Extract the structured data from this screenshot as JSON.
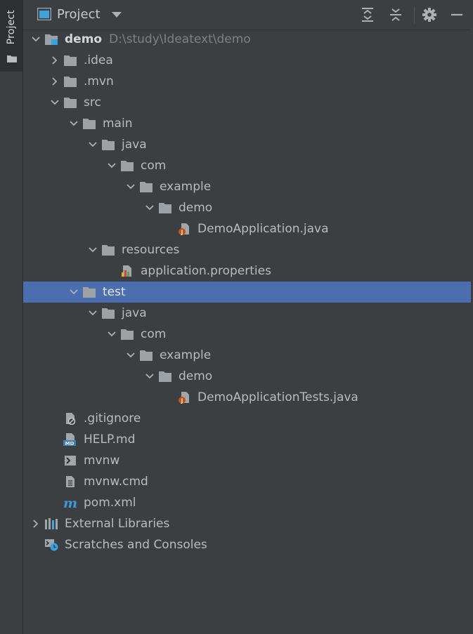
{
  "toolstrip": {
    "tab_label": "Project"
  },
  "header": {
    "title": "Project"
  },
  "tree": [
    {
      "label": "demo",
      "path": "D:\\study\\Ideatext\\demo",
      "icon": "module-folder-icon",
      "chevron": "down",
      "indent": 0,
      "bold": true
    },
    {
      "label": ".idea",
      "icon": "folder-icon",
      "chevron": "right",
      "indent": 1
    },
    {
      "label": ".mvn",
      "icon": "folder-icon",
      "chevron": "right",
      "indent": 1
    },
    {
      "label": "src",
      "icon": "folder-icon",
      "chevron": "down",
      "indent": 1
    },
    {
      "label": "main",
      "icon": "folder-icon",
      "chevron": "down",
      "indent": 2
    },
    {
      "label": "java",
      "icon": "folder-icon",
      "chevron": "down",
      "indent": 3
    },
    {
      "label": "com",
      "icon": "folder-icon",
      "chevron": "down",
      "indent": 4
    },
    {
      "label": "example",
      "icon": "folder-icon",
      "chevron": "down",
      "indent": 5
    },
    {
      "label": "demo",
      "icon": "folder-icon",
      "chevron": "down",
      "indent": 6
    },
    {
      "label": "DemoApplication.java",
      "icon": "java-file-icon",
      "chevron": "none",
      "indent": 7
    },
    {
      "label": "resources",
      "icon": "folder-icon",
      "chevron": "down",
      "indent": 3
    },
    {
      "label": "application.properties",
      "icon": "properties-file-icon",
      "chevron": "none",
      "indent": 4
    },
    {
      "label": "test",
      "icon": "folder-icon",
      "chevron": "down",
      "indent": 2,
      "selected": true
    },
    {
      "label": "java",
      "icon": "folder-icon",
      "chevron": "down",
      "indent": 3
    },
    {
      "label": "com",
      "icon": "folder-icon",
      "chevron": "down",
      "indent": 4
    },
    {
      "label": "example",
      "icon": "folder-icon",
      "chevron": "down",
      "indent": 5
    },
    {
      "label": "demo",
      "icon": "folder-icon",
      "chevron": "down",
      "indent": 6
    },
    {
      "label": "DemoApplicationTests.java",
      "icon": "java-file-icon",
      "chevron": "none",
      "indent": 7
    },
    {
      "label": ".gitignore",
      "icon": "ignore-file-icon",
      "chevron": "none",
      "indent": 1
    },
    {
      "label": "HELP.md",
      "icon": "markdown-file-icon",
      "chevron": "none",
      "indent": 1
    },
    {
      "label": "mvnw",
      "icon": "shell-script-icon",
      "chevron": "none",
      "indent": 1
    },
    {
      "label": "mvnw.cmd",
      "icon": "text-file-icon",
      "chevron": "none",
      "indent": 1
    },
    {
      "label": "pom.xml",
      "icon": "maven-icon",
      "chevron": "none",
      "indent": 1
    },
    {
      "label": "External Libraries",
      "icon": "libraries-icon",
      "chevron": "right",
      "indent": 0
    },
    {
      "label": "Scratches and Consoles",
      "icon": "scratches-icon",
      "chevron": "none",
      "indent": 0
    }
  ]
}
